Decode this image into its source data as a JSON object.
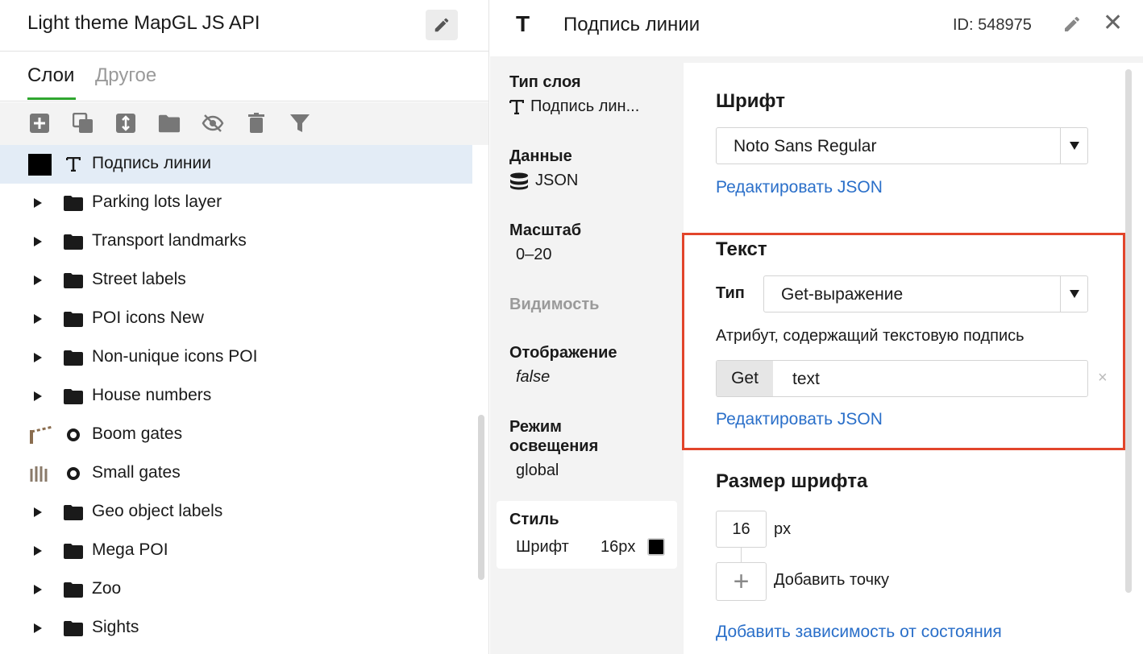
{
  "left_panel": {
    "title": "Light theme MapGL JS API",
    "tabs": [
      {
        "label": "Слои",
        "active": true
      },
      {
        "label": "Другое",
        "active": false
      }
    ],
    "toolbar_icons": [
      "add-layer-icon",
      "duplicate-icon",
      "reorder-icon",
      "folder-icon",
      "hide-icon",
      "trash-icon",
      "filter-icon"
    ],
    "layers": [
      {
        "label": "Подпись линии",
        "kind": "text-layer",
        "selected": true
      },
      {
        "label": "Parking lots layer",
        "kind": "group"
      },
      {
        "label": "Transport landmarks",
        "kind": "group"
      },
      {
        "label": "Street labels",
        "kind": "group"
      },
      {
        "label": "POI icons New",
        "kind": "group"
      },
      {
        "label": "Non-unique icons POI",
        "kind": "group"
      },
      {
        "label": "House numbers",
        "kind": "group"
      },
      {
        "label": "Boom gates",
        "kind": "point-layer"
      },
      {
        "label": "Small gates",
        "kind": "point-layer"
      },
      {
        "label": "Geo object labels",
        "kind": "group"
      },
      {
        "label": "Mega POI",
        "kind": "group"
      },
      {
        "label": "Zoo",
        "kind": "group"
      },
      {
        "label": "Sights",
        "kind": "group"
      }
    ]
  },
  "right_panel": {
    "header": {
      "icon": "T",
      "title": "Подпись линии",
      "id_text": "ID: 548975",
      "close": "✕"
    },
    "properties": {
      "layer_type": {
        "title": "Тип слоя",
        "value": "Подпись лин..."
      },
      "data": {
        "title": "Данные",
        "value": "JSON"
      },
      "zoom": {
        "title": "Масштаб",
        "value": "0–20"
      },
      "visibility": {
        "title": "Видимость"
      },
      "display": {
        "title": "Отображение",
        "value": "false"
      },
      "lighting": {
        "title_line1": "Режим",
        "title_line2": "освещения",
        "value": "global"
      },
      "style": {
        "title": "Стиль",
        "name": "Шрифт",
        "size": "16px",
        "color": "#000000"
      }
    },
    "font_section": {
      "title": "Шрифт",
      "select_value": "Noto Sans Regular",
      "edit_json": "Редактировать JSON"
    },
    "text_section": {
      "title": "Текст",
      "type_label": "Тип",
      "type_value": "Get-выражение",
      "attribute_label": "Атрибут, содержащий текстовую подпись",
      "get_button": "Get",
      "get_value": "text",
      "clear": "×",
      "edit_json": "Редактировать JSON",
      "highlight_color": "#e2452b"
    },
    "font_size_section": {
      "title": "Размер шрифта",
      "value": "16",
      "unit": "px",
      "add_point_icon": "+",
      "add_point": "Добавить точку",
      "add_dependency": "Добавить зависимость от состояния"
    }
  },
  "colors": {
    "accent_green": "#2fa62f",
    "link_blue": "#2a6fc9",
    "selected_row": "#e3ecf6"
  }
}
